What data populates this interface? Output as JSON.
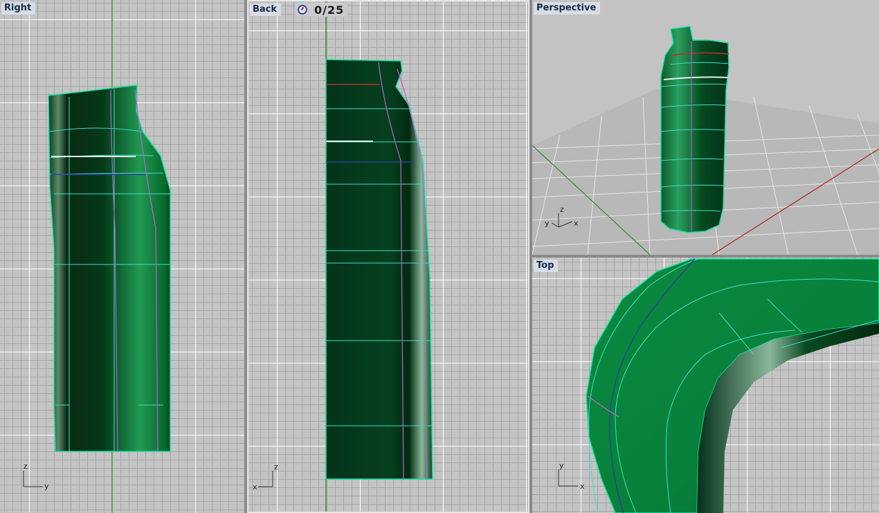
{
  "viewports": {
    "right": {
      "title": "Right",
      "axes": {
        "up": "z",
        "across": "y"
      }
    },
    "back": {
      "title": "Back",
      "frame_counter": "0/25",
      "counter_icon": "clock-icon",
      "axes": {
        "up": "z",
        "across": "x"
      }
    },
    "perspective": {
      "title": "Perspective",
      "axes": {
        "up": "z",
        "across": "x",
        "depth": "y"
      }
    },
    "top": {
      "title": "Top",
      "axes": {
        "up": "y",
        "across": "x"
      }
    }
  },
  "colors": {
    "viewport_bg": "#c4c4c4",
    "grid_major": "#ffffff",
    "grid_minor": "#a6a6a6",
    "model_green": "#0b7a3a",
    "isocurve": "#3de0c8",
    "edge_highlight": "#1ce4a6",
    "y_axis_line": "#2e8b2e",
    "x_axis_line": "#b22222"
  }
}
